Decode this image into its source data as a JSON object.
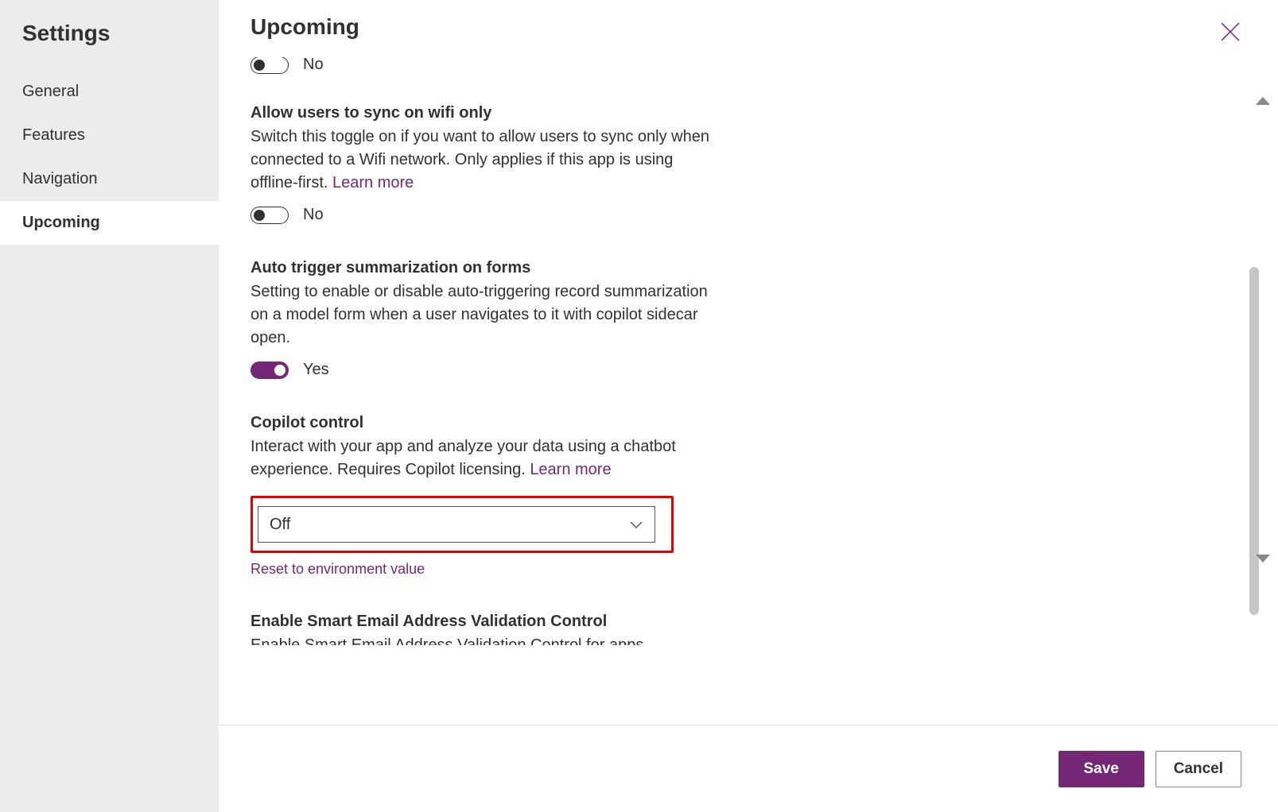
{
  "sidebar": {
    "title": "Settings",
    "items": [
      {
        "label": "General"
      },
      {
        "label": "Features"
      },
      {
        "label": "Navigation"
      },
      {
        "label": "Upcoming"
      }
    ]
  },
  "header": {
    "title": "Upcoming"
  },
  "toggle_values": {
    "no": "No",
    "yes": "Yes"
  },
  "settings": {
    "first_toggle": {
      "value": "No"
    },
    "wifi_sync": {
      "title": "Allow users to sync on wifi only",
      "desc": "Switch this toggle on if you want to allow users to sync only when connected to a Wifi network. Only applies if this app is using offline-first. ",
      "learn_more": "Learn more",
      "value": "No"
    },
    "auto_summarize": {
      "title": "Auto trigger summarization on forms",
      "desc": "Setting to enable or disable auto-triggering record summarization on a model form when a user navigates to it with copilot sidecar open.",
      "value": "Yes"
    },
    "copilot": {
      "title": "Copilot control",
      "desc": "Interact with your app and analyze your data using a chatbot experience. Requires Copilot licensing. ",
      "learn_more": "Learn more",
      "selected": "Off",
      "reset": "Reset to environment value"
    },
    "smart_email": {
      "title": "Enable Smart Email Address Validation Control",
      "desc": "Enable Smart Email Address Validation Control for apps"
    }
  },
  "footer": {
    "save": "Save",
    "cancel": "Cancel"
  }
}
